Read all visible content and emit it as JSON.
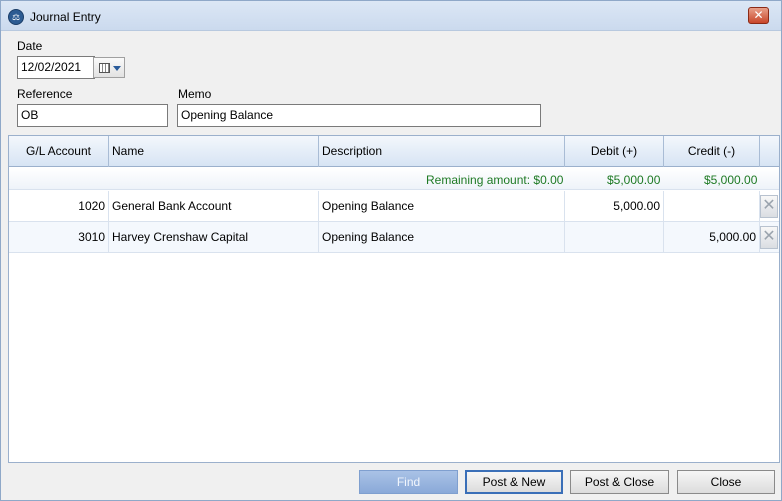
{
  "window": {
    "title": "Journal Entry",
    "icon": "scales-icon",
    "close_label": "✕"
  },
  "form": {
    "date_label": "Date",
    "date_value": "12/02/2021",
    "reference_label": "Reference",
    "reference_value": "OB",
    "memo_label": "Memo",
    "memo_value": "Opening Balance"
  },
  "grid": {
    "columns": [
      "G/L Account",
      "Name",
      "Description",
      "Debit (+)",
      "Credit (-)"
    ],
    "remaining": {
      "label": "Remaining amount: $0.00",
      "debit_total": "$5,000.00",
      "credit_total": "$5,000.00"
    },
    "rows": [
      {
        "account": "1020",
        "name": "General Bank Account",
        "description": "Opening Balance",
        "debit": "5,000.00",
        "credit": ""
      },
      {
        "account": "3010",
        "name": "Harvey Crenshaw Capital",
        "description": "Opening Balance",
        "debit": "",
        "credit": "5,000.00"
      }
    ],
    "remaining_color": "#1e7a24",
    "alt_row_color": "#f4f8fd"
  },
  "buttons": {
    "find": "Find",
    "post_new": "Post & New",
    "post_close": "Post & Close",
    "close": "Close"
  }
}
